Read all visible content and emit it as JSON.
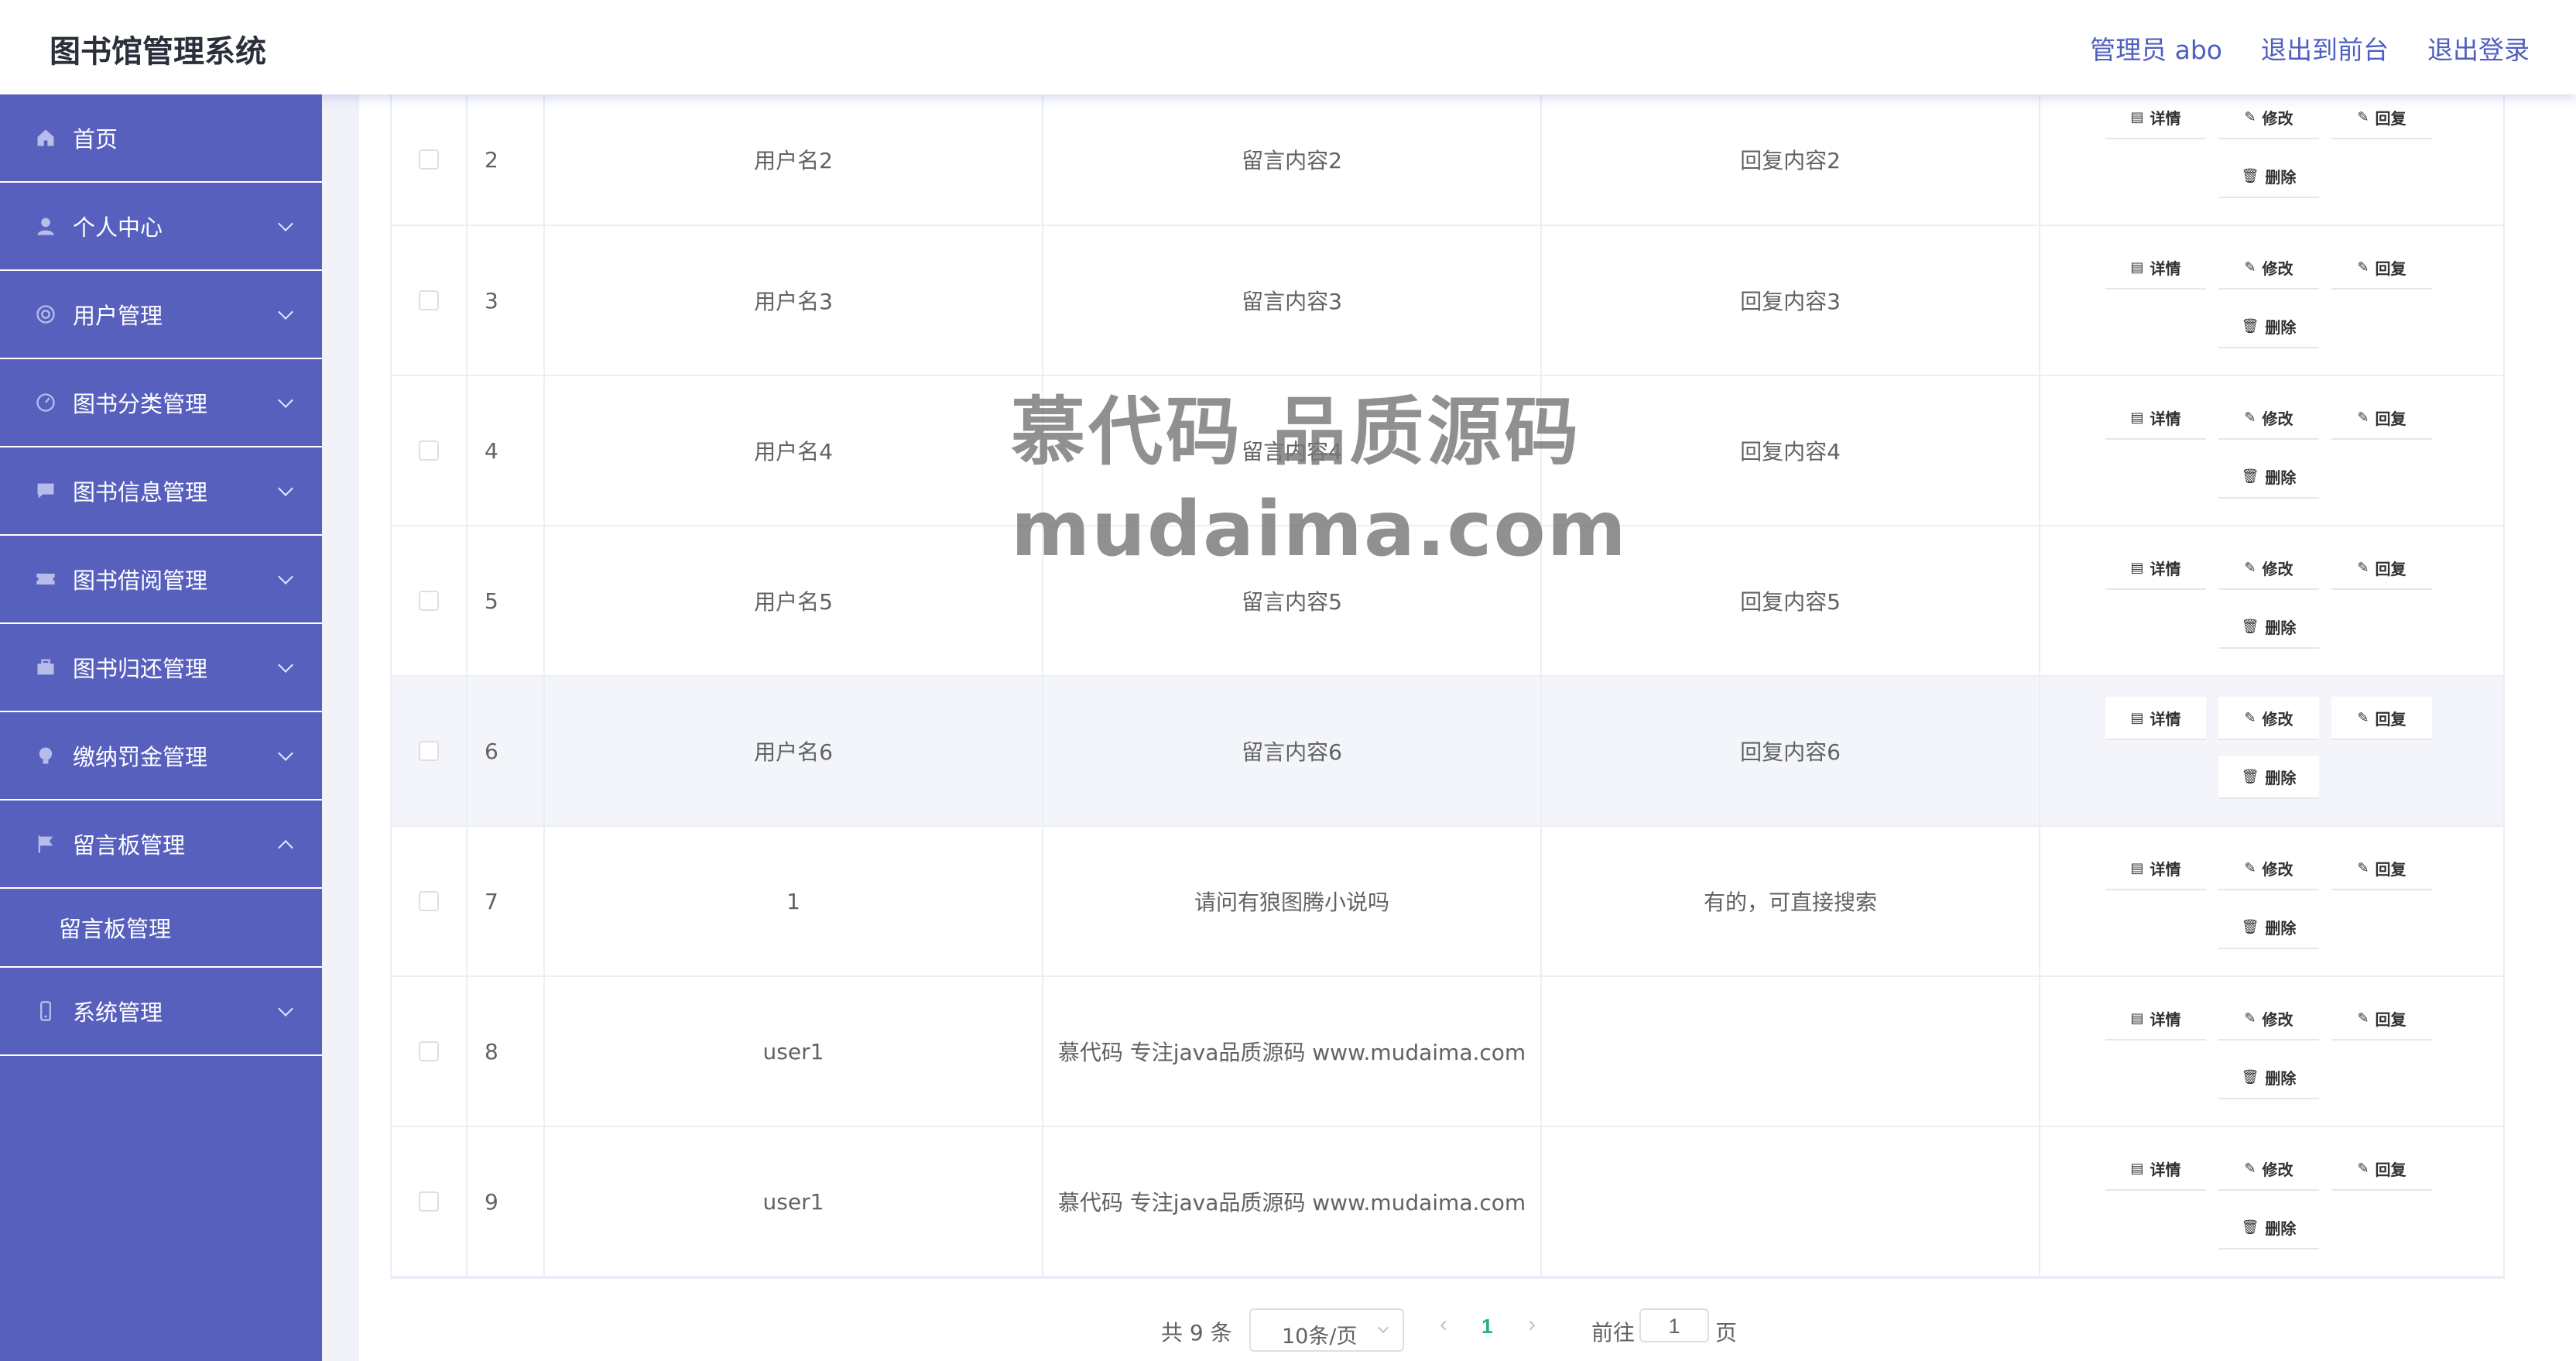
{
  "header": {
    "title": "图书馆管理系统",
    "admin_label": "管理员 abo",
    "front_label": "退出到前台",
    "logout_label": "退出登录"
  },
  "sidebar": {
    "items": [
      {
        "label": "首页",
        "icon": "home-icon"
      },
      {
        "label": "个人中心",
        "icon": "user-icon"
      },
      {
        "label": "用户管理",
        "icon": "lifebuoy-icon"
      },
      {
        "label": "图书分类管理",
        "icon": "gauge-icon"
      },
      {
        "label": "图书信息管理",
        "icon": "chat-icon"
      },
      {
        "label": "图书借阅管理",
        "icon": "ticket-icon"
      },
      {
        "label": "图书归还管理",
        "icon": "briefcase-icon"
      },
      {
        "label": "缴纳罚金管理",
        "icon": "bulb-icon"
      },
      {
        "label": "留言板管理",
        "icon": "flag-icon"
      },
      {
        "label": "系统管理",
        "icon": "phone-icon"
      }
    ],
    "sub_item": "留言板管理"
  },
  "table": {
    "rows": [
      {
        "idx": "2",
        "user": "用户名2",
        "msg": "留言内容2",
        "reply": "回复内容2"
      },
      {
        "idx": "3",
        "user": "用户名3",
        "msg": "留言内容3",
        "reply": "回复内容3"
      },
      {
        "idx": "4",
        "user": "用户名4",
        "msg": "留言内容4",
        "reply": "回复内容4"
      },
      {
        "idx": "5",
        "user": "用户名5",
        "msg": "留言内容5",
        "reply": "回复内容5"
      },
      {
        "idx": "6",
        "user": "用户名6",
        "msg": "留言内容6",
        "reply": "回复内容6"
      },
      {
        "idx": "7",
        "user": "1",
        "msg": "请问有狼图腾小说吗",
        "reply": "有的，可直接搜索"
      },
      {
        "idx": "8",
        "user": "user1",
        "msg": "慕代码 专注java品质源码 www.mudaima.com",
        "reply": ""
      },
      {
        "idx": "9",
        "user": "user1",
        "msg": "慕代码 专注java品质源码 www.mudaima.com",
        "reply": ""
      }
    ],
    "ops": {
      "detail": "详情",
      "edit": "修改",
      "reply": "回复",
      "delete": "删除"
    }
  },
  "pager": {
    "total": "共 9 条",
    "page_size": "10条/页",
    "current_page": "1",
    "goto_label": "前往",
    "goto_value": "1",
    "page_label": "页"
  },
  "watermark": {
    "line1": "慕代码 品质源码",
    "line2": "mudaima.com"
  },
  "colors": {
    "sidebar": "#5761bd",
    "header_link": "#4e5fbf",
    "active_page": "#1fae8e"
  }
}
